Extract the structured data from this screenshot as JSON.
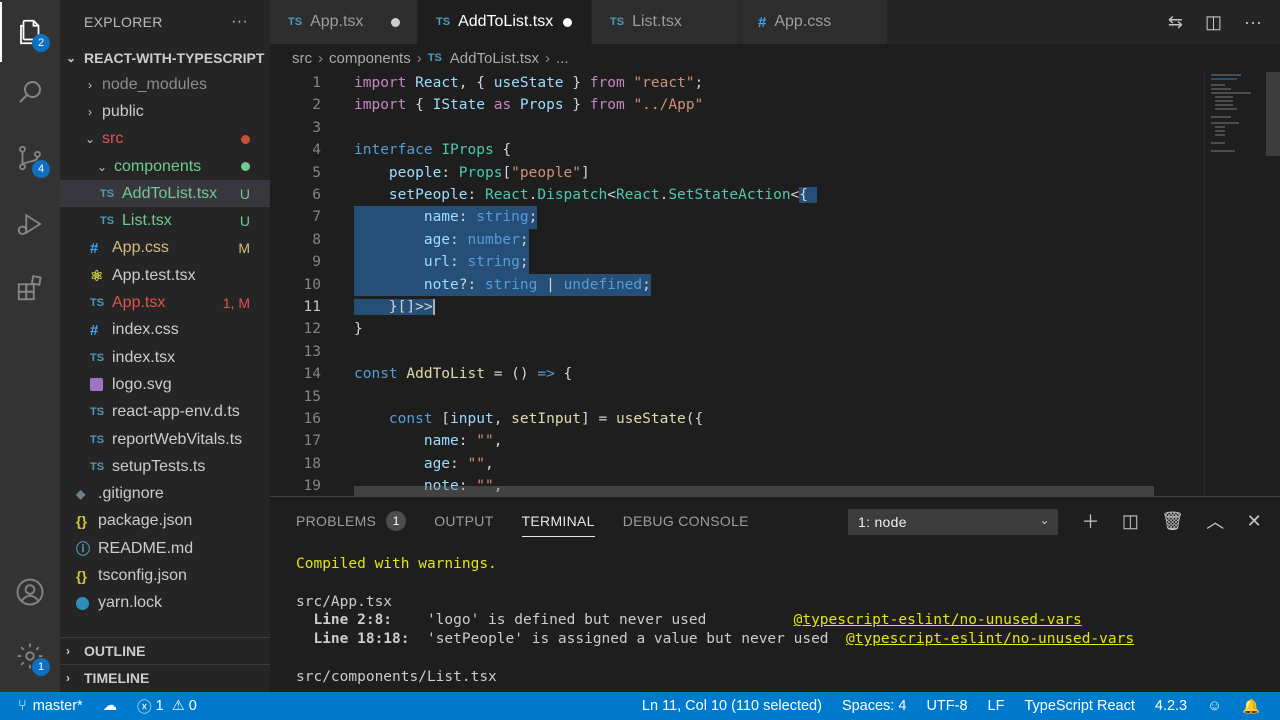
{
  "activity_bar": {
    "explorer_badge": "2",
    "scm_badge": "4",
    "settings_badge": "1"
  },
  "sidebar": {
    "title": "EXPLORER",
    "more": "···",
    "project": "REACT-WITH-TYPESCRIPT",
    "tree": [
      {
        "label": "node_modules",
        "status": ""
      },
      {
        "label": "public",
        "status": ""
      },
      {
        "label": "src",
        "status": ""
      },
      {
        "label": "components",
        "status": ""
      },
      {
        "label": "AddToList.tsx",
        "status": "U",
        "icon": "TS"
      },
      {
        "label": "List.tsx",
        "status": "U",
        "icon": "TS"
      },
      {
        "label": "App.css",
        "status": "M",
        "icon": "#"
      },
      {
        "label": "App.test.tsx",
        "status": "",
        "icon": "⚛"
      },
      {
        "label": "App.tsx",
        "status": "1, M",
        "icon": "TS"
      },
      {
        "label": "index.css",
        "status": "",
        "icon": "#"
      },
      {
        "label": "index.tsx",
        "status": "",
        "icon": "TS"
      },
      {
        "label": "logo.svg",
        "status": "",
        "icon": ""
      },
      {
        "label": "react-app-env.d.ts",
        "status": "",
        "icon": "TS"
      },
      {
        "label": "reportWebVitals.ts",
        "status": "",
        "icon": "TS"
      },
      {
        "label": "setupTests.ts",
        "status": "",
        "icon": "TS"
      },
      {
        "label": ".gitignore",
        "status": "",
        "icon": "◆"
      },
      {
        "label": "package.json",
        "status": "",
        "icon": "{}"
      },
      {
        "label": "README.md",
        "status": "",
        "icon": "ⓘ"
      },
      {
        "label": "tsconfig.json",
        "status": "",
        "icon": "{}"
      },
      {
        "label": "yarn.lock",
        "status": "",
        "icon": ""
      }
    ],
    "outline": "OUTLINE",
    "timeline": "TIMELINE"
  },
  "tabs": [
    {
      "label": "App.tsx",
      "icon": "TS"
    },
    {
      "label": "AddToList.tsx",
      "icon": "TS"
    },
    {
      "label": "List.tsx",
      "icon": "TS"
    },
    {
      "label": "App.css",
      "icon": "#"
    }
  ],
  "breadcrumb": {
    "part1": "src",
    "part2": "components",
    "part3": "AddToList.tsx",
    "part4": "..."
  },
  "editor": {
    "line_numbers": [
      "1",
      "2",
      "3",
      "4",
      "5",
      "6",
      "7",
      "8",
      "9",
      "10",
      "11",
      "12",
      "13",
      "14",
      "15",
      "16",
      "17",
      "18",
      "19"
    ]
  },
  "panel": {
    "tab_problems": "PROBLEMS",
    "problems_count": "1",
    "tab_output": "OUTPUT",
    "tab_terminal": "TERMINAL",
    "tab_debug": "DEBUG CONSOLE",
    "terminal_select": "1: node",
    "terminal": {
      "l1": "Compiled with warnings.",
      "l2": "src/App.tsx",
      "l3a": "  Line 2:8:",
      "l3b": "    'logo' is defined but never used          ",
      "l3c": "@typescript-eslint/no-unused-vars",
      "l4a": "  Line 18:18:",
      "l4b": "  'setPeople' is assigned a value but never used  ",
      "l4c": "@typescript-eslint/no-unused-vars",
      "l5": "src/components/List.tsx"
    }
  },
  "status_bar": {
    "branch": "master*",
    "errors": "1",
    "warnings": "0",
    "cursor": "Ln 11, Col 10 (110 selected)",
    "spaces": "Spaces: 4",
    "encoding": "UTF-8",
    "eol": "LF",
    "language": "TypeScript React",
    "version": "4.2.3"
  },
  "colors": {
    "accent": "#007acc",
    "selection": "#264f78"
  }
}
